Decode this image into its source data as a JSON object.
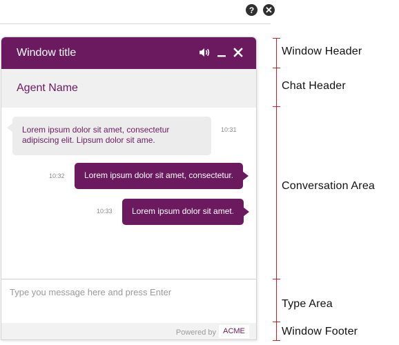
{
  "top_bar": {
    "help_symbol": "?",
    "close_symbol": "✕"
  },
  "window": {
    "title": "Window title",
    "accent_color": "#6b1a5f"
  },
  "chat_header": {
    "agent_name": "Agent Name"
  },
  "conversation": {
    "messages": [
      {
        "direction": "incoming",
        "text": "Lorem ipsum dolor sit amet, consectetur adipiscing elit. Lipsum dolor sit ame.",
        "time": "10:31"
      },
      {
        "direction": "outgoing",
        "text": "Lorem ipsum dolor sit amet, consectetur.",
        "time": "10:32"
      },
      {
        "direction": "outgoing",
        "text": "Lorem ipsum dolor sit amet.",
        "time": "10:33"
      }
    ]
  },
  "type_area": {
    "placeholder": "Type you message here and press Enter"
  },
  "footer": {
    "powered_by": "Powered by",
    "brand": "ACME"
  },
  "annotations": {
    "window_header": "Window Header",
    "chat_header": "Chat Header",
    "conversation_area": "Conversation Area",
    "type_area": "Type Area",
    "window_footer": "Window Footer"
  },
  "icons": [
    "help-icon",
    "close-icon",
    "volume-icon",
    "minimize-icon",
    "close-icon"
  ]
}
